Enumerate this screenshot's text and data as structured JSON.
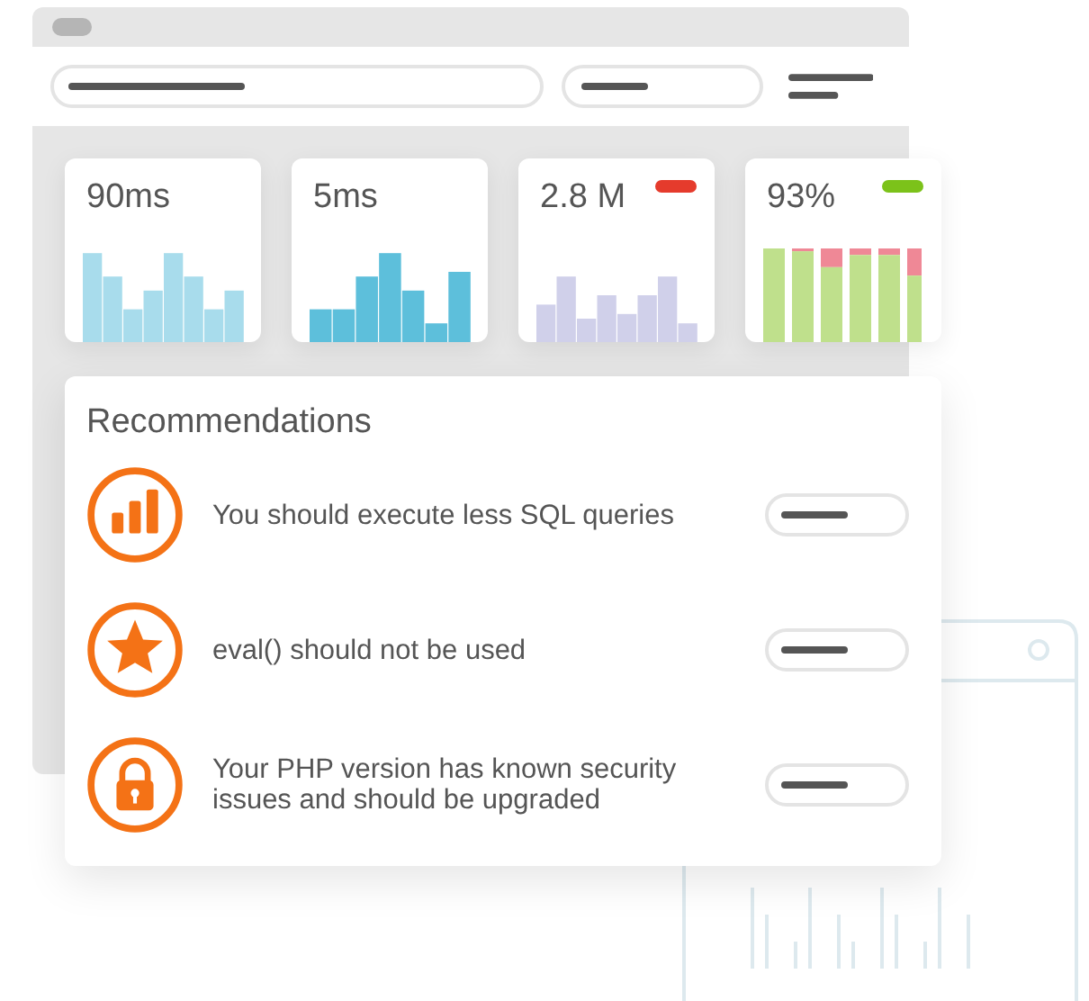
{
  "metrics": [
    {
      "value": "90ms",
      "kind": "bars",
      "color": "#a8dcec"
    },
    {
      "value": "5ms",
      "kind": "bars",
      "color": "#5dbfdb"
    },
    {
      "value": "2.8 M",
      "kind": "bars",
      "color": "#d0d0ea",
      "badge": {
        "color": "#e53b2c"
      }
    },
    {
      "value": "93%",
      "kind": "stacked",
      "color": "#bfe08c",
      "badge": {
        "color": "#7cc21a"
      }
    }
  ],
  "recommendations": {
    "title": "Recommendations",
    "items": [
      {
        "kind": "chart",
        "text": "You should execute less SQL queries"
      },
      {
        "kind": "star",
        "text": "eval() should not be used"
      },
      {
        "kind": "lock",
        "text": "Your PHP version has known security issues and should be upgraded"
      }
    ]
  }
}
